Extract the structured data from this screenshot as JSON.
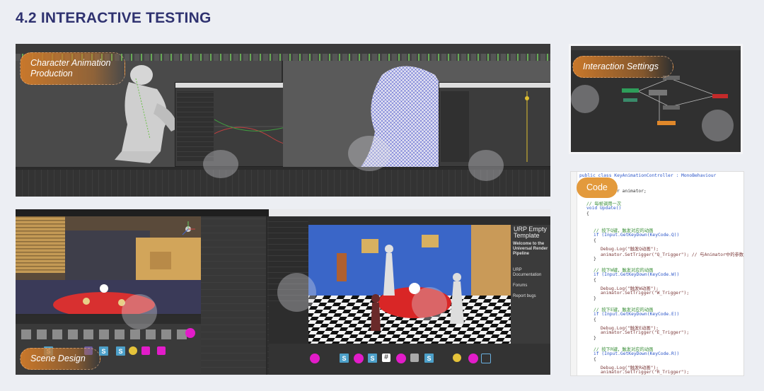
{
  "page": {
    "title": "4.2 INTERACTIVE TESTING"
  },
  "panels": {
    "animation": {
      "label_line1": "Character Animation",
      "label_line2": "Production"
    },
    "interaction": {
      "label": "Interaction Settings"
    },
    "scene": {
      "label": "Scene Design"
    },
    "code": {
      "label": "Code"
    },
    "unity_inspector": {
      "heading": "URP Empty Template",
      "welcome": "Welcome to the Universal Render Pipeline",
      "item1": "URP Documentation",
      "item2": "Forums",
      "item3": "Report bugs"
    }
  },
  "code_lines": [
    {
      "cls": "c-kw",
      "text": "public class KeyAnimationController : MonoBehaviour"
    },
    {
      "cls": "c-com",
      "text": "// Animator组件"
    },
    {
      "cls": "c-pl",
      "text": "public Animator animator;"
    },
    {
      "cls": "c-com",
      "text": "// 每帧调用一次"
    },
    {
      "cls": "c-kw",
      "text": "void Update()"
    },
    {
      "cls": "c-pl",
      "text": "{"
    },
    {
      "cls": "c-com",
      "text": "// 按下Q键，触发对应的动画"
    },
    {
      "cls": "c-kw",
      "text": "if (Input.GetKeyDown(KeyCode.Q))"
    },
    {
      "cls": "c-pl",
      "text": "{"
    },
    {
      "cls": "c-txt",
      "text": "Debug.Log(\"触发Q动画\");"
    },
    {
      "cls": "c-txt",
      "text": "animator.SetTrigger(\"Q_Trigger\"); // 与Animator中的参数名一致"
    },
    {
      "cls": "c-pl",
      "text": "}"
    },
    {
      "cls": "c-com",
      "text": "// 按下W键，触发对应的动画"
    },
    {
      "cls": "c-kw",
      "text": "if (Input.GetKeyDown(KeyCode.W))"
    },
    {
      "cls": "c-pl",
      "text": "{"
    },
    {
      "cls": "c-txt",
      "text": "Debug.Log(\"触发W动画\");"
    },
    {
      "cls": "c-txt",
      "text": "animator.SetTrigger(\"W_Trigger\");"
    },
    {
      "cls": "c-pl",
      "text": "}"
    },
    {
      "cls": "c-com",
      "text": "// 按下E键，触发对应的动画"
    },
    {
      "cls": "c-kw",
      "text": "if (Input.GetKeyDown(KeyCode.E))"
    },
    {
      "cls": "c-pl",
      "text": "{"
    },
    {
      "cls": "c-txt",
      "text": "Debug.Log(\"触发E动画\");"
    },
    {
      "cls": "c-txt",
      "text": "animator.SetTrigger(\"E_Trigger\");"
    },
    {
      "cls": "c-pl",
      "text": "}"
    },
    {
      "cls": "c-com",
      "text": "// 按下R键，触发对应的动画"
    },
    {
      "cls": "c-kw",
      "text": "if (Input.GetKeyDown(KeyCode.R))"
    },
    {
      "cls": "c-pl",
      "text": "{"
    },
    {
      "cls": "c-txt",
      "text": "Debug.Log(\"触发R动画\");"
    },
    {
      "cls": "c-txt",
      "text": "animator.SetTrigger(\"R_Trigger\");"
    }
  ],
  "colors": {
    "title": "#2f3270",
    "tag_orange": "#c9782b",
    "code_tag": "#e39a3c",
    "magenta": "#e21cc9",
    "dark_ui": "#2b2b2b"
  }
}
